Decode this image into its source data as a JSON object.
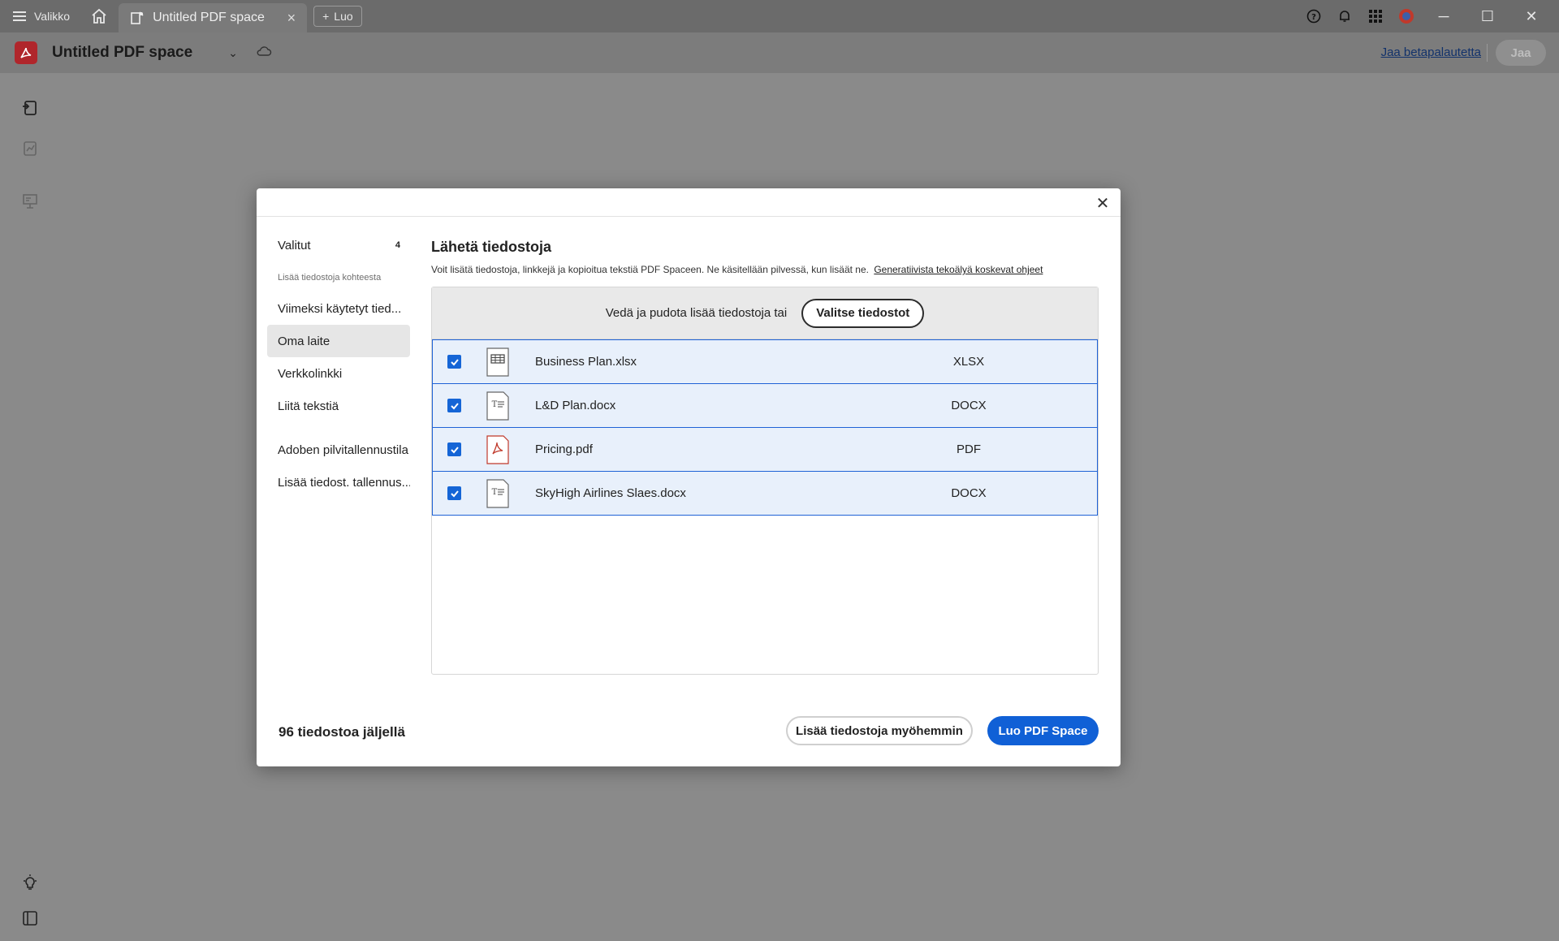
{
  "tabbar": {
    "menu_label": "Valikko",
    "tab_title": "Untitled PDF space",
    "tab_close": "×",
    "new_tab_label": "Luo",
    "new_tab_plus": "+",
    "minimize": "─",
    "maximize": "☐",
    "close": "✕"
  },
  "appbar": {
    "title": "Untitled PDF space",
    "chevron": "⌄",
    "beta_link": "Jaa betapalautetta",
    "share_label": "Jaa"
  },
  "dialog": {
    "close": "✕",
    "sidebar": {
      "selected_label": "Valitut",
      "selected_count": "4",
      "caption": "Lisää tiedostoja kohteesta",
      "items": [
        "Viimeksi käytetyt tied...",
        "Oma laite",
        "Verkkolinkki",
        "Liitä tekstiä",
        "Adoben pilvitallennustila",
        "Lisää tiedost. tallennus..."
      ]
    },
    "title": "Lähetä tiedostoja",
    "description": "Voit lisätä tiedostoja, linkkejä ja kopioitua tekstiä PDF Spaceen. Ne käsitellään pilvessä, kun lisäät ne.",
    "guidelines_link": "Generatiivista tekoälyä koskevat ohjeet",
    "drop_text": "Vedä ja pudota lisää tiedostoja tai",
    "choose_button": "Valitse tiedostot",
    "files": [
      {
        "name": "Business Plan.xlsx",
        "type": "XLSX",
        "icon": "spreadsheet-file-icon"
      },
      {
        "name": "L&D Plan.docx",
        "type": "DOCX",
        "icon": "document-file-icon"
      },
      {
        "name": "Pricing.pdf",
        "type": "PDF",
        "icon": "pdf-file-icon"
      },
      {
        "name": "SkyHigh Airlines Slaes.docx",
        "type": "DOCX",
        "icon": "document-file-icon"
      }
    ],
    "remaining": "96 tiedostoa jäljellä",
    "later_button": "Lisää tiedostoja myöhemmin",
    "create_button": "Luo PDF Space"
  },
  "colors": {
    "accent": "#1060d6",
    "selected_row_bg": "#e8f0fb",
    "brand_red": "#b0262b"
  }
}
